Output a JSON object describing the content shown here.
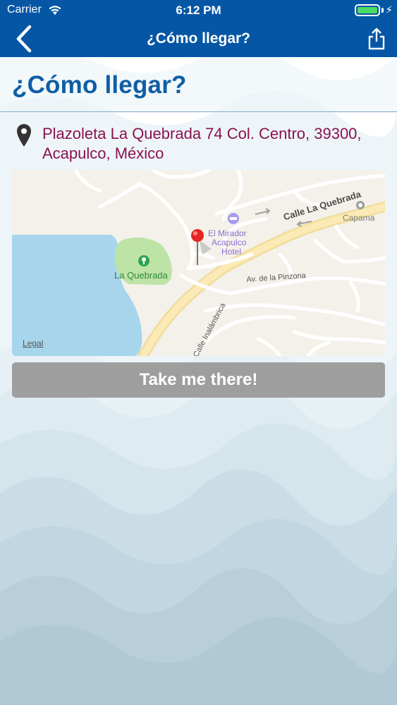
{
  "status_bar": {
    "carrier": "Carrier",
    "time": "6:12 PM",
    "battery_level": 1.0
  },
  "nav_bar": {
    "title": "¿Cómo llegar?",
    "back_icon": "chevron-left-icon",
    "share_icon": "share-icon",
    "color": "#0557a6"
  },
  "page": {
    "title": "¿Cómo llegar?",
    "address": "Plazoleta La Quebrada 74 Col. Centro, 39300, Acapulco, México",
    "address_color": "#8b1250",
    "title_color": "#0f5ea5"
  },
  "map": {
    "street_label": "Calle La Quebrada",
    "hotel_label_1": "El Mirador",
    "hotel_label_2": "Acapulco",
    "hotel_label_3": "Hotel",
    "park_label": "La Quebrada",
    "avenue_label": "Av. de la Pinzona",
    "side_street_label": "Calle Inalámbrica",
    "capama_label": "Capama",
    "legal_label": "Legal",
    "pin_icon": "map-pin-icon"
  },
  "actions": {
    "take_me_there": "Take me there!"
  }
}
